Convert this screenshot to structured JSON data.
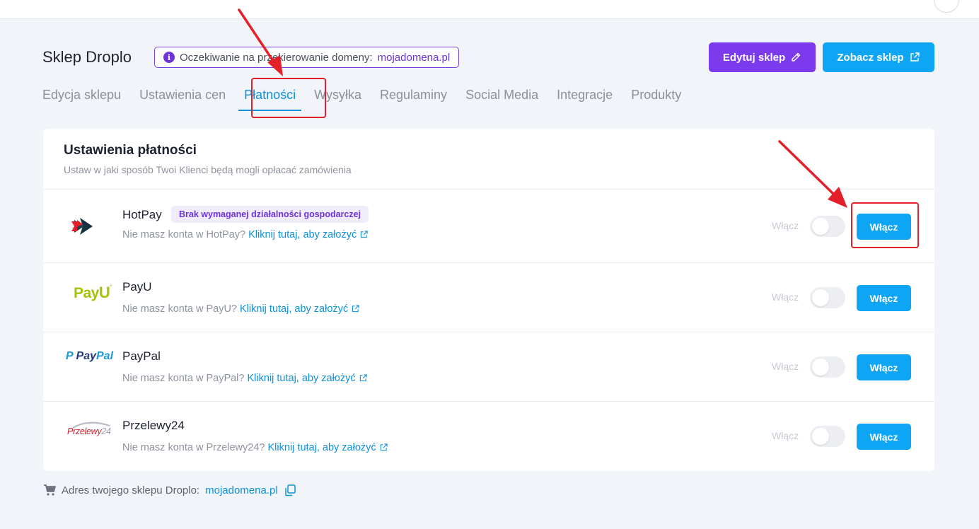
{
  "header": {
    "shop_title": "Sklep Droplo",
    "domain_badge_prefix": "Oczekiwanie na przekierowanie domeny:",
    "domain": "mojadomena.pl",
    "edit_button": "Edytuj sklep",
    "view_button": "Zobacz sklep"
  },
  "tabs": [
    {
      "label": "Edycja sklepu"
    },
    {
      "label": "Ustawienia cen"
    },
    {
      "label": "Płatności"
    },
    {
      "label": "Wysyłka"
    },
    {
      "label": "Regulaminy"
    },
    {
      "label": "Social Media"
    },
    {
      "label": "Integracje"
    },
    {
      "label": "Produkty"
    }
  ],
  "active_tab": "Płatności",
  "card": {
    "title": "Ustawienia płatności",
    "subtitle": "Ustaw w jaki sposób Twoi Klienci będą mogli opłacać zamówienia"
  },
  "providers": [
    {
      "name": "HotPay",
      "tag": "Brak wymaganej działalności gospodarczej",
      "account_prefix": "Nie masz konta w HotPay?",
      "account_link": "Kliknij tutaj, aby założyć",
      "toggle_label": "Włącz",
      "enabled": false,
      "button": "Włącz"
    },
    {
      "name": "PayU",
      "logo_text": "PayU",
      "account_prefix": "Nie masz konta w PayU?",
      "account_link": "Kliknij tutaj, aby założyć",
      "toggle_label": "Włącz",
      "enabled": false,
      "button": "Włącz"
    },
    {
      "name": "PayPal",
      "logo_text": "PayPal",
      "account_prefix": "Nie masz konta w PayPal?",
      "account_link": "Kliknij tutaj, aby założyć",
      "toggle_label": "Włącz",
      "enabled": false,
      "button": "Włącz"
    },
    {
      "name": "Przelewy24",
      "logo_text": "Przelewy24",
      "account_prefix": "Nie masz konta w Przelewy24?",
      "account_link": "Kliknij tutaj, aby założyć",
      "toggle_label": "Włącz",
      "enabled": false,
      "button": "Włącz"
    }
  ],
  "footer": {
    "label": "Adres twojego sklepu Droplo:",
    "domain": "mojadomena.pl"
  },
  "colors": {
    "accent_blue": "#0ea5f4",
    "accent_purple": "#7c3aed",
    "highlight_red": "#e3202a"
  },
  "icons": [
    "info-icon",
    "pencil-icon",
    "external-link-icon",
    "cart-icon",
    "copy-icon"
  ]
}
